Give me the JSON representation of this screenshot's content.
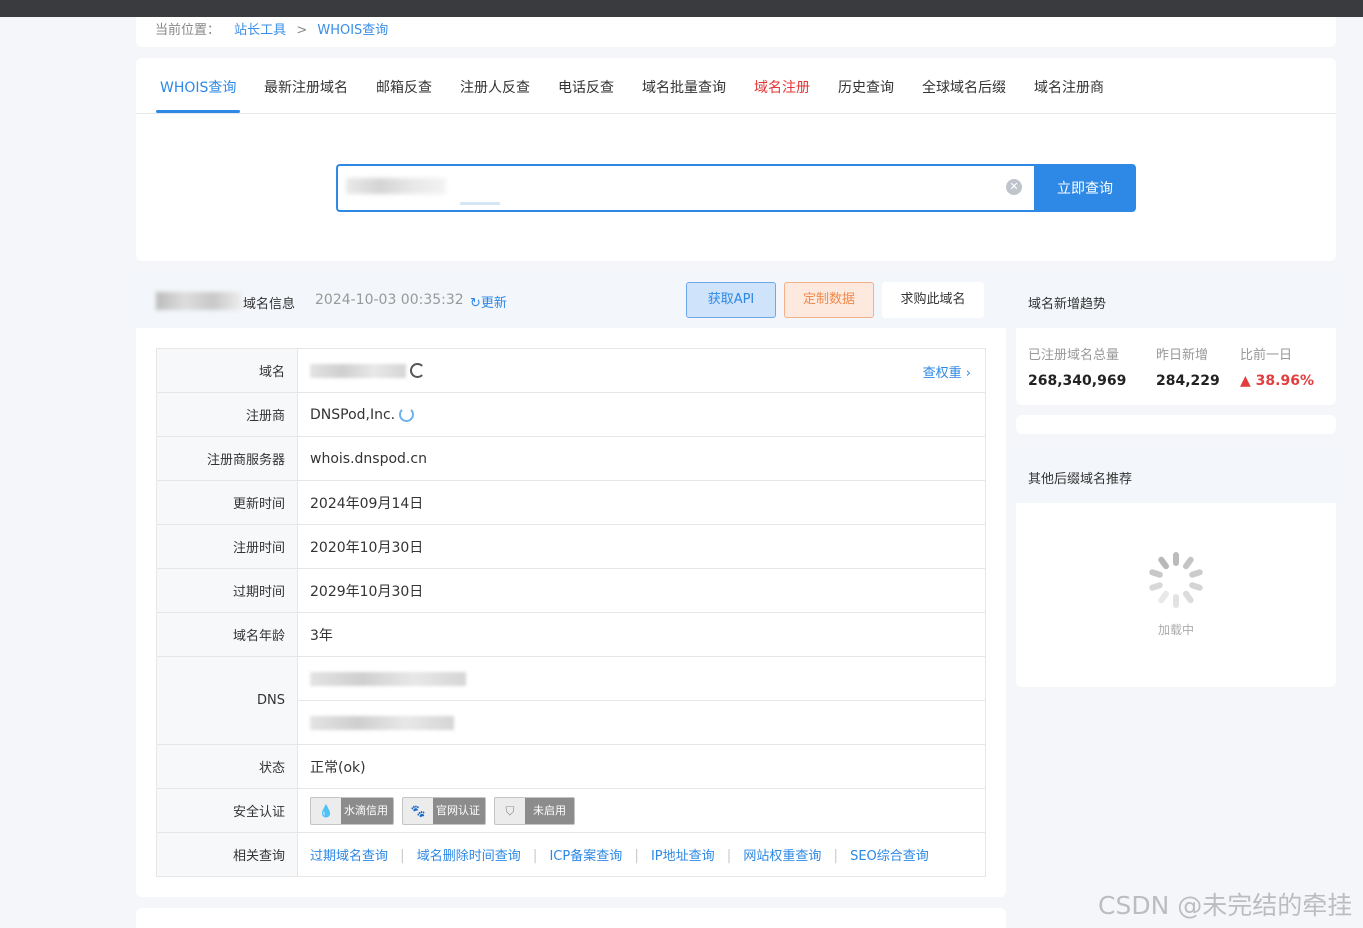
{
  "breadcrumb": {
    "prefix": "当前位置：",
    "item1": "站长工具",
    "separator": ">",
    "item2": "WHOIS查询"
  },
  "tabs": [
    {
      "label": "WHOIS查询",
      "active": true
    },
    {
      "label": "最新注册域名"
    },
    {
      "label": "邮箱反查"
    },
    {
      "label": "注册人反查"
    },
    {
      "label": "电话反查"
    },
    {
      "label": "域名批量查询"
    },
    {
      "label": "域名注册",
      "highlight": "red"
    },
    {
      "label": "历史查询"
    },
    {
      "label": "全球域名后缀"
    },
    {
      "label": "域名注册商"
    }
  ],
  "search": {
    "button_label": "立即查询",
    "clear_icon": "clear-circle-icon"
  },
  "info": {
    "header_label": "域名信息",
    "updated_time": "2024-10-03 00:35:32",
    "refresh_label": "更新",
    "api_button": "获取API",
    "custom_button": "定制数据",
    "buy_button": "求购此域名",
    "weight_link": "查权重"
  },
  "rows": {
    "domain_key": "域名",
    "registrar_key": "注册商",
    "registrar_val": "DNSPod,Inc.",
    "server_key": "注册商服务器",
    "server_val": "whois.dnspod.cn",
    "updated_key": "更新时间",
    "updated_val": "2024年09月14日",
    "created_key": "注册时间",
    "created_val": "2020年10月30日",
    "expire_key": "过期时间",
    "expire_val": "2029年10月30日",
    "age_key": "域名年龄",
    "age_val": "3年",
    "dns_key": "DNS",
    "status_key": "状态",
    "status_val": "正常(ok)",
    "security_key": "安全认证",
    "related_key": "相关查询"
  },
  "badges": [
    {
      "icon": "water-drop-icon",
      "label": "水滴信用"
    },
    {
      "icon": "paw-icon",
      "label": "官网认证"
    },
    {
      "icon": "ssl-shield-icon",
      "label": "未启用"
    }
  ],
  "related_links": [
    "过期域名查询",
    "域名删除时间查询",
    "ICP备案查询",
    "IP地址查询",
    "网站权重查询",
    "SEO综合查询"
  ],
  "trend": {
    "title": "域名新增趋势",
    "total_label": "已注册域名总量",
    "total_value": "268,340,969",
    "new_label": "昨日新增",
    "new_value": "284,229",
    "compare_label": "比前一日",
    "compare_value": "38.96%",
    "compare_icon": "arrow-up-icon",
    "up_color": "#e23e3e"
  },
  "recommend": {
    "title": "其他后缀域名推荐",
    "loading": "加载中"
  },
  "watermark": "CSDN @未完结的牵挂",
  "colors": {
    "accent": "#2d88e6",
    "red": "#e53535",
    "orange": "#f08a4b"
  }
}
